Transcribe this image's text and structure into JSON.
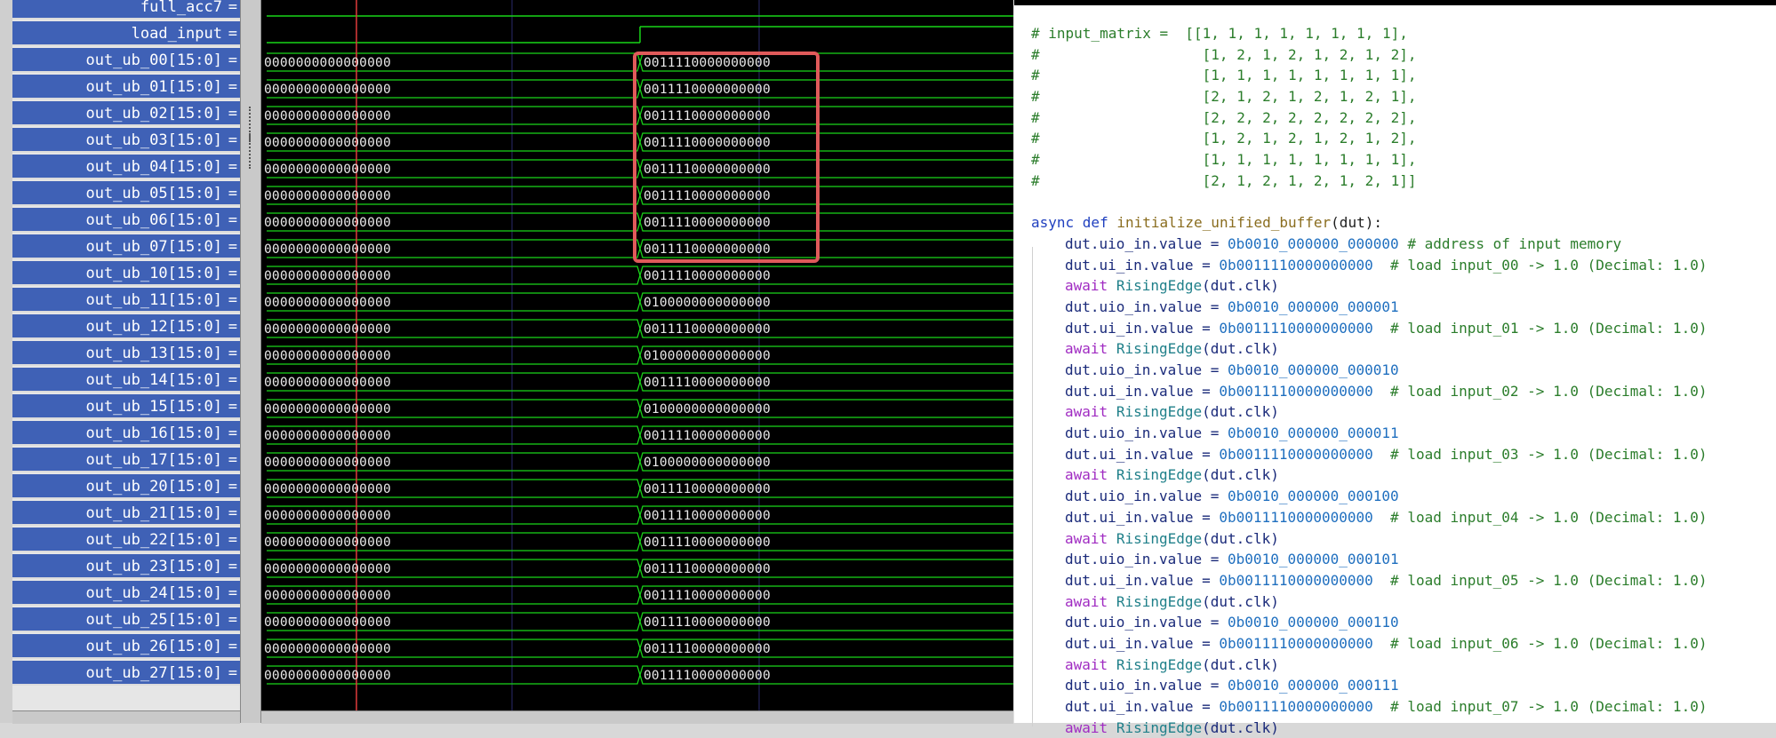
{
  "signal_panel": {
    "signals": [
      "full_acc7",
      "load_input",
      "out_ub_00[15:0]",
      "out_ub_01[15:0]",
      "out_ub_02[15:0]",
      "out_ub_03[15:0]",
      "out_ub_04[15:0]",
      "out_ub_05[15:0]",
      "out_ub_06[15:0]",
      "out_ub_07[15:0]",
      "out_ub_10[15:0]",
      "out_ub_11[15:0]",
      "out_ub_12[15:0]",
      "out_ub_13[15:0]",
      "out_ub_14[15:0]",
      "out_ub_15[15:0]",
      "out_ub_16[15:0]",
      "out_ub_17[15:0]",
      "out_ub_20[15:0]",
      "out_ub_21[15:0]",
      "out_ub_22[15:0]",
      "out_ub_23[15:0]",
      "out_ub_24[15:0]",
      "out_ub_25[15:0]",
      "out_ub_26[15:0]",
      "out_ub_27[15:0]"
    ],
    "equals": "="
  },
  "waveform": {
    "initial_value": "0000000000000000",
    "final_values": [
      "0011110000000000",
      "0011110000000000",
      "0011110000000000",
      "0011110000000000",
      "0011110000000000",
      "0011110000000000",
      "0011110000000000",
      "0011110000000000",
      "0011110000000000",
      "0100000000000000",
      "0011110000000000",
      "0100000000000000",
      "0011110000000000",
      "0100000000000000",
      "0011110000000000",
      "0100000000000000",
      "0011110000000000",
      "0011110000000000",
      "0011110000000000",
      "0011110000000000",
      "0011110000000000",
      "0011110000000000",
      "0011110000000000",
      "0011110000000000"
    ],
    "colors": {
      "wave": "#19d619",
      "cursor": "#e03a3a",
      "highlight": "#e05a5a",
      "grid": "#2a2a6a"
    }
  },
  "code": {
    "matrix_comment": [
      "# input_matrix =  [[1, 1, 1, 1, 1, 1, 1, 1],",
      "#                   [1, 2, 1, 2, 1, 2, 1, 2],",
      "#                   [1, 1, 1, 1, 1, 1, 1, 1],",
      "#                   [2, 1, 2, 1, 2, 1, 2, 1],",
      "#                   [2, 2, 2, 2, 2, 2, 2, 2],",
      "#                   [1, 2, 1, 2, 1, 2, 1, 2],",
      "#                   [1, 1, 1, 1, 1, 1, 1, 1],",
      "#                   [2, 1, 2, 1, 2, 1, 2, 1]]"
    ],
    "def_keyword": "async def",
    "func_name": "initialize_unified_buffer",
    "func_param": "(dut):",
    "blocks": [
      {
        "addr": "0b0010_000000_000000",
        "addr_comment": " # address of input memory",
        "data": "0b0011110000000000",
        "data_comment": "  # load input_00 -> 1.0 (Decimal: 1.0)"
      },
      {
        "addr": "0b0010_000000_000001",
        "addr_comment": "",
        "data": "0b0011110000000000",
        "data_comment": "  # load input_01 -> 1.0 (Decimal: 1.0)"
      },
      {
        "addr": "0b0010_000000_000010",
        "addr_comment": "",
        "data": "0b0011110000000000",
        "data_comment": "  # load input_02 -> 1.0 (Decimal: 1.0)"
      },
      {
        "addr": "0b0010_000000_000011",
        "addr_comment": "",
        "data": "0b0011110000000000",
        "data_comment": "  # load input_03 -> 1.0 (Decimal: 1.0)"
      },
      {
        "addr": "0b0010_000000_000100",
        "addr_comment": "",
        "data": "0b0011110000000000",
        "data_comment": "  # load input_04 -> 1.0 (Decimal: 1.0)"
      },
      {
        "addr": "0b0010_000000_000101",
        "addr_comment": "",
        "data": "0b0011110000000000",
        "data_comment": "  # load input_05 -> 1.0 (Decimal: 1.0)"
      },
      {
        "addr": "0b0010_000000_000110",
        "addr_comment": "",
        "data": "0b0011110000000000",
        "data_comment": "  # load input_06 -> 1.0 (Decimal: 1.0)"
      },
      {
        "addr": "0b0010_000000_000111",
        "addr_comment": "",
        "data": "0b0011110000000000",
        "data_comment": "  # load input_07 -> 1.0 (Decimal: 1.0)"
      }
    ],
    "uio_prefix": "dut.uio_in.value = ",
    "ui_prefix": "dut.ui_in.value = ",
    "await_kw": "await",
    "rising_edge": "RisingEdge",
    "clk_arg": "(dut.clk)"
  }
}
